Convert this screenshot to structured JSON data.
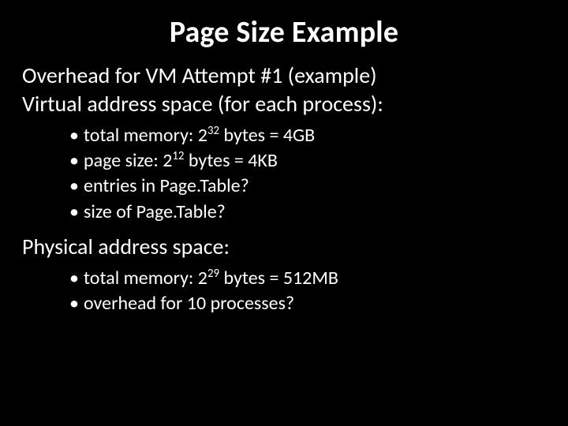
{
  "title": "Page Size Example",
  "line1": "Overhead for VM Attempt #1 (example)",
  "line2": "Virtual address space (for each process):",
  "va_bullets": [
    {
      "pre": "total memory: 2",
      "sup": "32",
      "post": " bytes = 4GB"
    },
    {
      "pre": "page size: 2",
      "sup": "12",
      "post": " bytes = 4KB"
    },
    {
      "pre": "entries in Page.Table?",
      "sup": "",
      "post": ""
    },
    {
      "pre": "size of Page.Table?",
      "sup": "",
      "post": ""
    }
  ],
  "line3": "Physical address space:",
  "pa_bullets": [
    {
      "pre": "total memory: 2",
      "sup": "29",
      "post": " bytes = 512MB"
    },
    {
      "pre": "overhead for 10 processes?",
      "sup": "",
      "post": ""
    }
  ],
  "bullet_char": "•"
}
